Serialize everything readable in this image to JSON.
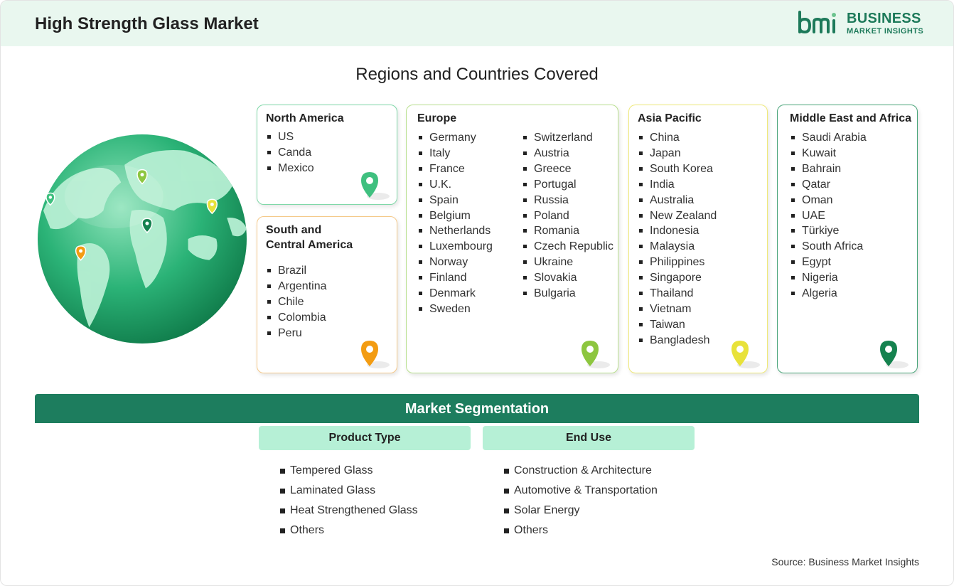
{
  "header": {
    "title": "High Strength Glass Market",
    "logo": {
      "mark": "bmi",
      "line1": "BUSINESS",
      "line2": "MARKET INSIGHTS"
    }
  },
  "regions_section": {
    "title": "Regions and Countries Covered",
    "regions": [
      {
        "name": "North America",
        "countries": [
          "US",
          "Canda",
          "Mexico"
        ],
        "color": "#3fc07f"
      },
      {
        "name": "South and Central America",
        "countries": [
          "Brazil",
          "Argentina",
          "Chile",
          "Colombia",
          "Peru"
        ],
        "color": "#f39c12"
      },
      {
        "name": "Europe",
        "countries_col1": [
          "Germany",
          "Italy",
          "France",
          "U.K.",
          "Spain",
          "Belgium",
          "Netherlands",
          "Luxembourg",
          "Norway",
          "Finland",
          "Denmark",
          "Sweden"
        ],
        "countries_col2": [
          "Switzerland",
          "Austria",
          "Greece",
          "Portugal",
          "Russia",
          "Poland",
          "Romania",
          "Czech Republic",
          "Ukraine",
          "Slovakia",
          "Bulgaria"
        ],
        "color": "#8dc63f"
      },
      {
        "name": "Asia Pacific",
        "countries": [
          "China",
          "Japan",
          "South Korea",
          "India",
          "Australia",
          "New Zealand",
          "Indonesia",
          "Malaysia",
          "Philippines",
          "Singapore",
          "Thailand",
          "Vietnam",
          "Taiwan",
          "Bangladesh"
        ],
        "color": "#e8e23a"
      },
      {
        "name": "Middle East and Africa",
        "countries": [
          "Saudi Arabia",
          "Kuwait",
          "Bahrain",
          "Qatar",
          "Oman",
          "UAE",
          "Türkiye",
          "South Africa",
          "Egypt",
          "Nigeria",
          "Algeria"
        ],
        "color": "#15824f"
      }
    ]
  },
  "segmentation": {
    "title": "Market Segmentation",
    "groups": [
      {
        "name": "Product Type",
        "items": [
          "Tempered Glass",
          "Laminated Glass",
          "Heat Strengthened Glass",
          "Others"
        ]
      },
      {
        "name": "End Use",
        "items": [
          "Construction & Architecture",
          "Automotive & Transportation",
          "Solar Energy",
          "Others"
        ]
      }
    ]
  },
  "source": "Source: Business Market Insights",
  "colors": {
    "brand": "#1d7d5e",
    "header_bg": "#e9f7ef",
    "segment_head_bg": "#b6f0d6"
  }
}
